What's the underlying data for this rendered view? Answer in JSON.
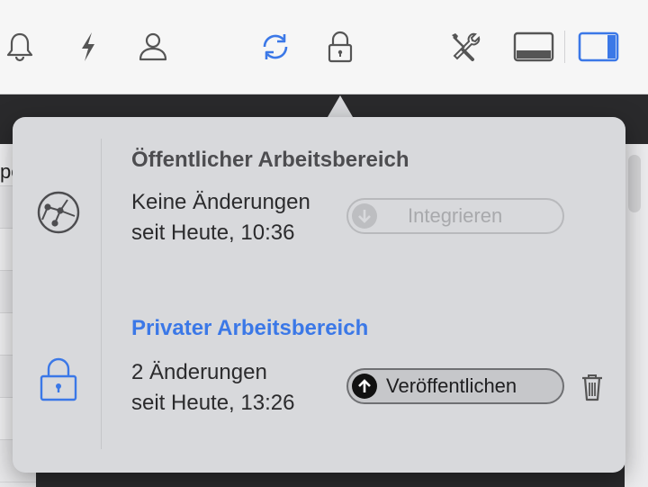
{
  "toolbar": {
    "icons": [
      "bell-icon",
      "bolt-icon",
      "person-icon",
      "sync-icon",
      "lock-icon",
      "tools-icon",
      "panel-bottom-icon",
      "panel-right-icon"
    ],
    "accent": "#3b78e7"
  },
  "background": {
    "left_fragment": "pe"
  },
  "popover": {
    "public": {
      "title": "Öffentlicher Arbeitsbereich",
      "status_line1": "Keine Änderungen",
      "status_line2": "seit Heute, 10:36",
      "button_label": "Integrieren",
      "button_enabled": false,
      "icon": "network-globe-icon"
    },
    "private": {
      "title": "Privater Arbeitsbereich",
      "status_line1": "2 Änderungen",
      "status_line2": "seit Heute, 13:26",
      "button_label": "Veröffentlichen",
      "button_enabled": true,
      "icon": "lock-icon",
      "title_color": "#3b78e7"
    },
    "trash_icon": "trash-icon"
  }
}
